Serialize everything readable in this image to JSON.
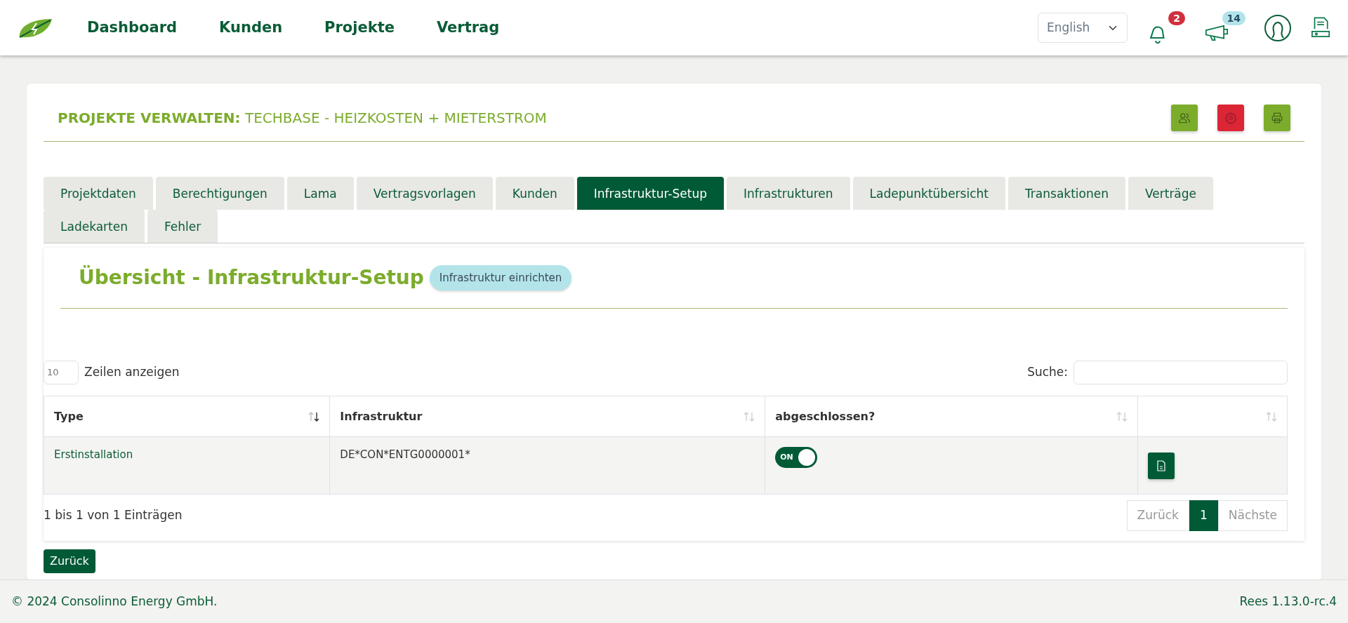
{
  "nav": {
    "links": [
      {
        "label": "Dashboard"
      },
      {
        "label": "Kunden"
      },
      {
        "label": "Projekte"
      },
      {
        "label": "Vertrag"
      }
    ]
  },
  "language": {
    "value": "English"
  },
  "notifications": {
    "count": "2"
  },
  "news": {
    "count": "14"
  },
  "page": {
    "title": "**PROJEKTE VERWALTEN:** TECHBASE - HEIZKOSTEN + MIETERSTROM"
  },
  "header_buttons": [
    {
      "kind": "users",
      "color": "#7cac2c"
    },
    {
      "kind": "settings",
      "color": "#dc2535"
    },
    {
      "kind": "print",
      "color": "#7cac2c"
    }
  ],
  "tabs": [
    {
      "label": "Projektdaten",
      "selected": false
    },
    {
      "label": "Berechtigungen",
      "selected": false
    },
    {
      "label": "Lama",
      "selected": false
    },
    {
      "label": "Vertragsvorlagen",
      "selected": false
    },
    {
      "label": "Kunden",
      "selected": false
    },
    {
      "label": "Infrastruktur-Setup",
      "selected": true
    },
    {
      "label": "Infrastrukturen",
      "selected": false
    },
    {
      "label": "Ladepunktübersicht",
      "selected": false
    },
    {
      "label": "Transaktionen",
      "selected": false
    },
    {
      "label": "Verträge",
      "selected": false
    },
    {
      "label": "Ladekarten",
      "selected": false
    },
    {
      "label": "Fehler",
      "selected": false
    }
  ],
  "section": {
    "title": "Übersicht - Infrastruktur-Setup",
    "action": "Infrastruktur einrichten"
  },
  "table": {
    "length": "10",
    "length_label": "Zeilen anzeigen",
    "search_label": "Suche:",
    "columns": [
      {
        "label": "Type",
        "sorted": true
      },
      {
        "label": "Infrastruktur",
        "sorted": false
      },
      {
        "label": "abgeschlossen?",
        "sorted": false
      },
      {
        "sorted": false
      }
    ],
    "rows": [
      {
        "type": "Erstinstallation",
        "infrastruktur": "DE*CON*ENTG0000001*",
        "done": {
          "on": true,
          "label": "ON"
        }
      }
    ],
    "info": "1 bis 1 von 1 Einträgen",
    "pagination": [
      {
        "label": "Zurück",
        "selected": false,
        "disabled": true
      },
      {
        "label": "1",
        "selected": true,
        "disabled": false
      },
      {
        "label": "Nächste",
        "selected": false,
        "disabled": true
      }
    ]
  },
  "back_button": "Zurück",
  "footer": {
    "copyright": "© 2024 Consolinno Energy GmbH.",
    "version": "Rees 1.13.0-rc.4"
  }
}
